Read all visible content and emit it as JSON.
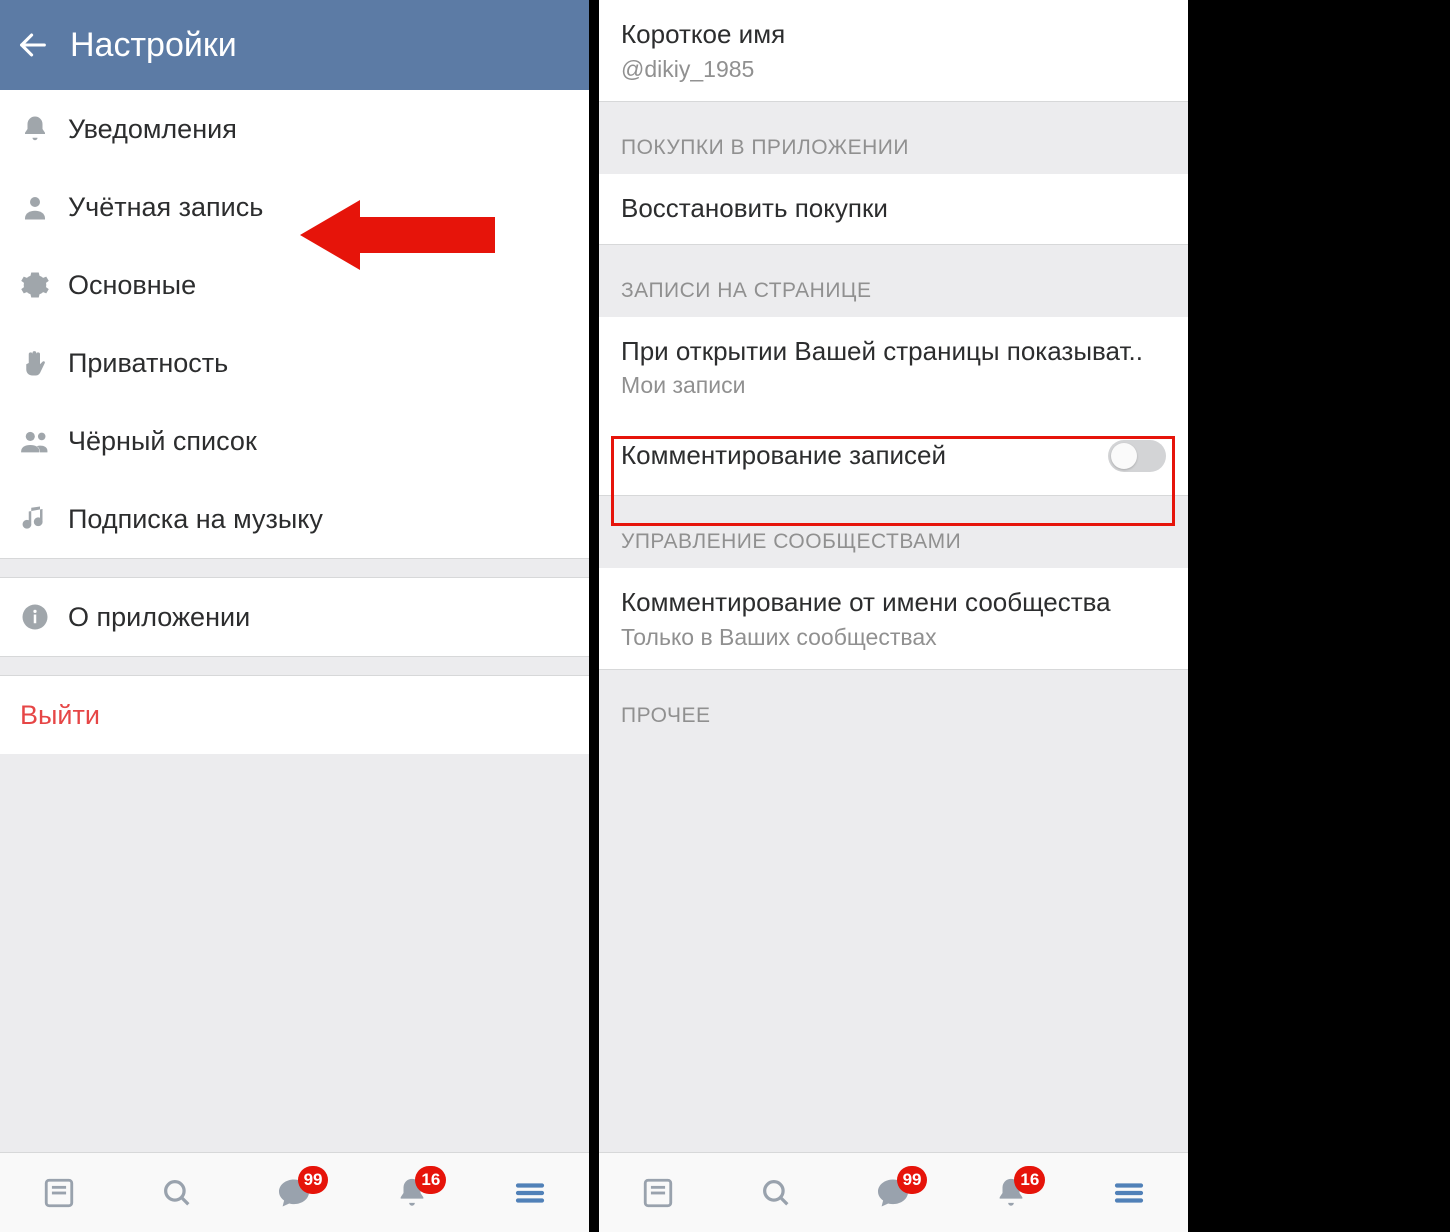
{
  "left": {
    "header_title": "Настройки",
    "items": [
      {
        "label": "Уведомления"
      },
      {
        "label": "Учётная запись"
      },
      {
        "label": "Основные"
      },
      {
        "label": "Приватность"
      },
      {
        "label": "Чёрный список"
      },
      {
        "label": "Подписка на музыку"
      }
    ],
    "about_label": "О приложении",
    "signout": "Выйти"
  },
  "right": {
    "short_name_title": "Короткое имя",
    "short_name_value": "@dikiy_1985",
    "section_purchases": "ПОКУПКИ В ПРИЛОЖЕНИИ",
    "restore_purchases": "Восстановить покупки",
    "section_wall": "ЗАПИСИ НА СТРАНИЦЕ",
    "page_open_title": "При открытии Вашей страницы показыват..",
    "page_open_value": "Мои записи",
    "commenting_title": "Комментирование записей",
    "section_communities": "УПРАВЛЕНИЕ СООБЩЕСТВАМИ",
    "community_comment_title": "Комментирование от имени сообщества",
    "community_comment_value": "Только в Ваших сообществах",
    "section_other": "ПРОЧЕЕ"
  },
  "tabs": {
    "badge_chat": "99",
    "badge_bell": "16"
  }
}
